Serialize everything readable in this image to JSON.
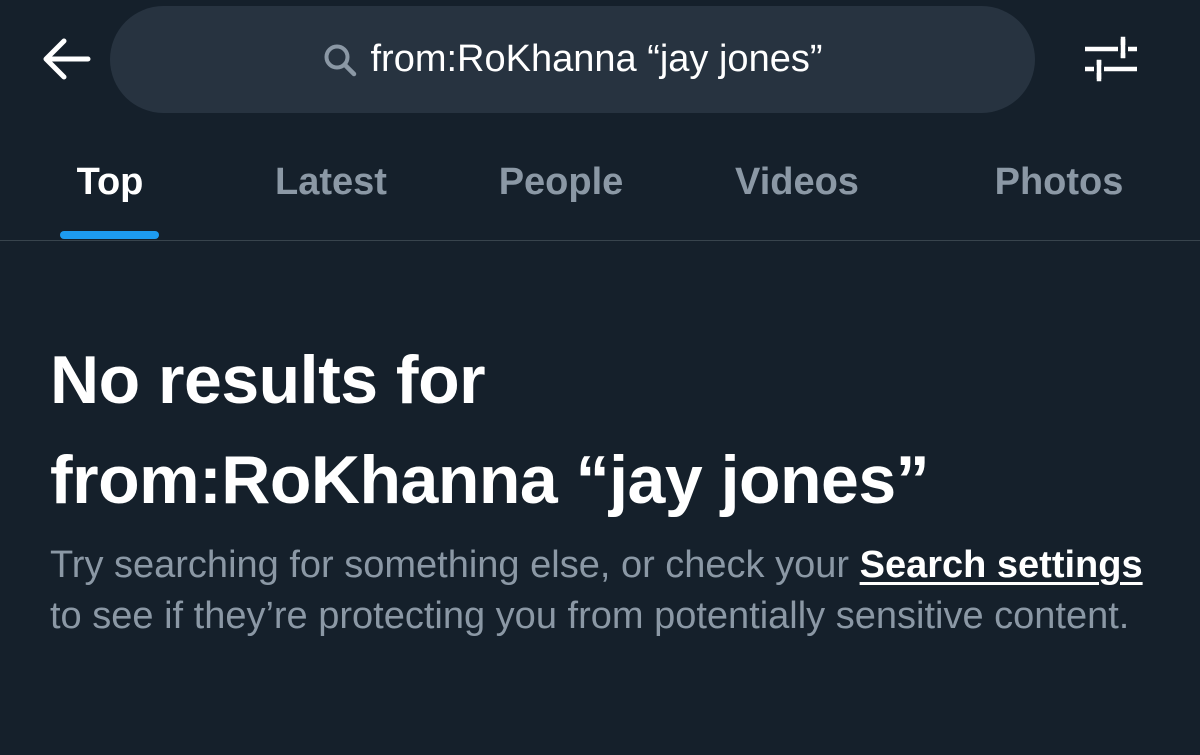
{
  "header": {
    "back_icon": "arrow-left-icon",
    "search": {
      "icon": "search-icon",
      "query": "from:RoKhanna “jay jones”"
    },
    "filter_icon": "sliders-icon"
  },
  "tabs": [
    {
      "label": "Top",
      "active": true
    },
    {
      "label": "Latest",
      "active": false
    },
    {
      "label": "People",
      "active": false
    },
    {
      "label": "Videos",
      "active": false
    },
    {
      "label": "Photos",
      "active": false
    }
  ],
  "empty_state": {
    "title_line1": "No results for",
    "title_line2": "from:RoKhanna “jay jones”",
    "body_before_link": "Try searching for something else, or check your ",
    "link_label": "Search settings",
    "body_after_link": " to see if they’re protecting you from potentially sensitive content."
  },
  "colors": {
    "background": "#15202b",
    "search_pill": "#273340",
    "accent": "#1d9bf0",
    "muted_text": "#8b98a5",
    "divider": "#38444d"
  }
}
